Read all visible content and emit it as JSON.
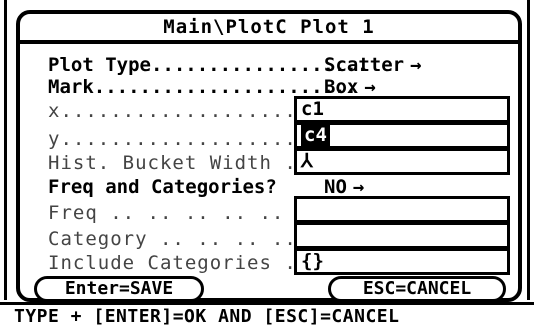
{
  "dialog": {
    "title": "Main\\PlotC Plot 1",
    "plot_type": {
      "label": "Plot Type...................",
      "value": "Scatter",
      "arrow": "→"
    },
    "mark": {
      "label": "Mark.......................",
      "value": "Box",
      "arrow": "→"
    },
    "x": {
      "label": "x...........................",
      "value": "c1"
    },
    "y": {
      "label": "y...........................",
      "value": "c4"
    },
    "hist_bucket": {
      "label": "Hist. Bucket Width ..",
      "value": "⅄"
    },
    "freq_cat": {
      "label": "Freq and Categories?",
      "value": "NO",
      "arrow": "→"
    },
    "freq": {
      "label": "Freq .. .. .. .. .. ..",
      "value": ""
    },
    "category": {
      "label": "Category .. .. .. .. ..",
      "value": ""
    },
    "include_cat": {
      "label": "Include Categories ..",
      "value": "{}"
    },
    "save_label": "Enter=SAVE",
    "cancel_label": "ESC=CANCEL"
  },
  "status_line": "TYPE + [ENTER]=OK AND [ESC]=CANCEL"
}
